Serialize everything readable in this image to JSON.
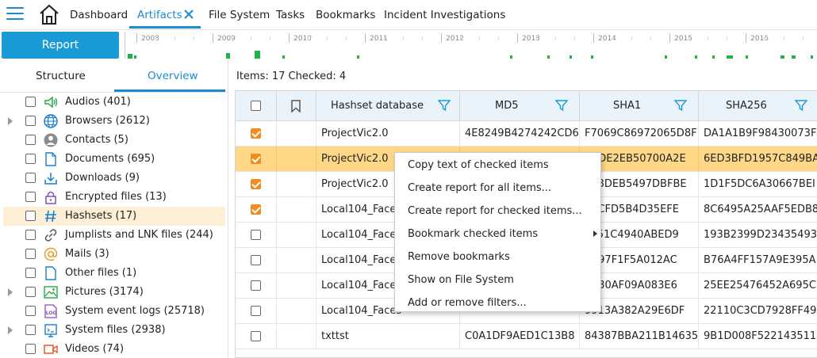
{
  "nav": {
    "tabs": [
      {
        "label": "Dashboard"
      },
      {
        "label": "Artifacts"
      },
      {
        "label": "File System"
      },
      {
        "label": "Tasks"
      },
      {
        "label": "Bookmarks"
      },
      {
        "label": "Incident Investigations"
      }
    ],
    "active_tab": "Artifacts",
    "accent_color": "#1a8ccf"
  },
  "report_button": {
    "label": "Report"
  },
  "timeline": {
    "years": [
      "2008",
      "2009",
      "2010",
      "2011",
      "2012",
      "2013",
      "2014",
      "2015",
      "2016"
    ],
    "bar_color": "#22b14c"
  },
  "left_panel": {
    "tabs": [
      {
        "label": "Structure"
      },
      {
        "label": "Overview"
      }
    ],
    "active_tab": "Overview",
    "items": [
      {
        "label": "Audios (401)",
        "icon": "speaker-icon",
        "expandable": false,
        "selected": false
      },
      {
        "label": "Browsers (2612)",
        "icon": "globe-icon",
        "expandable": true,
        "selected": false
      },
      {
        "label": "Contacts (5)",
        "icon": "person-icon",
        "expandable": false,
        "selected": false
      },
      {
        "label": "Documents (695)",
        "icon": "document-icon",
        "expandable": false,
        "selected": false
      },
      {
        "label": "Downloads (9)",
        "icon": "download-icon",
        "expandable": false,
        "selected": false
      },
      {
        "label": "Encrypted files (13)",
        "icon": "lock-icon",
        "expandable": false,
        "selected": false
      },
      {
        "label": "Hashsets (17)",
        "icon": "hash-icon",
        "expandable": false,
        "selected": true
      },
      {
        "label": "Jumplists and LNK files (244)",
        "icon": "link-icon",
        "expandable": false,
        "selected": false
      },
      {
        "label": "Mails (3)",
        "icon": "at-icon",
        "expandable": false,
        "selected": false
      },
      {
        "label": "Other files (1)",
        "icon": "file-icon",
        "expandable": false,
        "selected": false
      },
      {
        "label": "Pictures (3174)",
        "icon": "picture-icon",
        "expandable": true,
        "selected": false
      },
      {
        "label": "System event logs (25718)",
        "icon": "log-icon",
        "expandable": false,
        "selected": false
      },
      {
        "label": "System files (2938)",
        "icon": "system-icon",
        "expandable": true,
        "selected": false
      },
      {
        "label": "Videos (74)",
        "icon": "video-icon",
        "expandable": false,
        "selected": false
      }
    ]
  },
  "grid": {
    "summary": "Items: 17 Checked: 4",
    "columns": [
      {
        "label": "Hashset database"
      },
      {
        "label": "MD5"
      },
      {
        "label": "SHA1"
      },
      {
        "label": "SHA256"
      }
    ],
    "rows": [
      {
        "checked": true,
        "highlighted": false,
        "cells": [
          "ProjectVic2.0",
          "4E8249B4274242CD6",
          "F7069C86972065D8F",
          "DA1A1B9F98430073F"
        ]
      },
      {
        "checked": true,
        "highlighted": true,
        "cells": [
          "ProjectVic2.0",
          "",
          "ECDE2EB50700A2E",
          "6ED3BFD1957C849BA"
        ]
      },
      {
        "checked": true,
        "highlighted": false,
        "cells": [
          "ProjectVic2.0",
          "",
          "488DEB5497DBFBE",
          "1D1F5DC6A30667BEI"
        ]
      },
      {
        "checked": true,
        "highlighted": false,
        "cells": [
          "Local104_Faces",
          "",
          "E7CFD5B4D35EFE",
          "8C6495A25AAF5EDB8"
        ]
      },
      {
        "checked": false,
        "highlighted": false,
        "cells": [
          "Local104_Faces",
          "",
          "5F51C4940ABED9",
          "193B2399D23435493"
        ]
      },
      {
        "checked": false,
        "highlighted": false,
        "cells": [
          "Local104_Faces",
          "",
          "9A97F1F5A012AC",
          "B76A4FF157A9E395A"
        ]
      },
      {
        "checked": false,
        "highlighted": false,
        "cells": [
          "Local104_Faces",
          "",
          "8B30AF09A083E6",
          "25EE25476452A695C"
        ]
      },
      {
        "checked": false,
        "highlighted": false,
        "cells": [
          "Local104_Faces",
          "",
          "9913A382A29E6DF",
          "22110C3CD7928FF49"
        ]
      },
      {
        "checked": false,
        "highlighted": false,
        "cells": [
          "txttst",
          "C0A1DF9AED1C13B8",
          "84387BBA211B14635",
          "9B1D008F522143511"
        ]
      }
    ],
    "highlight_color": "#ffd887",
    "check_color": "#f28c1c"
  },
  "context_menu": {
    "items": [
      {
        "label": "Copy text of checked items",
        "submenu": false
      },
      {
        "label": "Create report for all items...",
        "submenu": false
      },
      {
        "label": "Create report for checked items...",
        "submenu": false
      },
      {
        "label": "Bookmark checked items",
        "submenu": true
      },
      {
        "label": "Remove bookmarks",
        "submenu": false
      },
      {
        "label": "Show on File System",
        "submenu": false
      },
      {
        "label": "Add or remove filters...",
        "submenu": false
      }
    ]
  }
}
